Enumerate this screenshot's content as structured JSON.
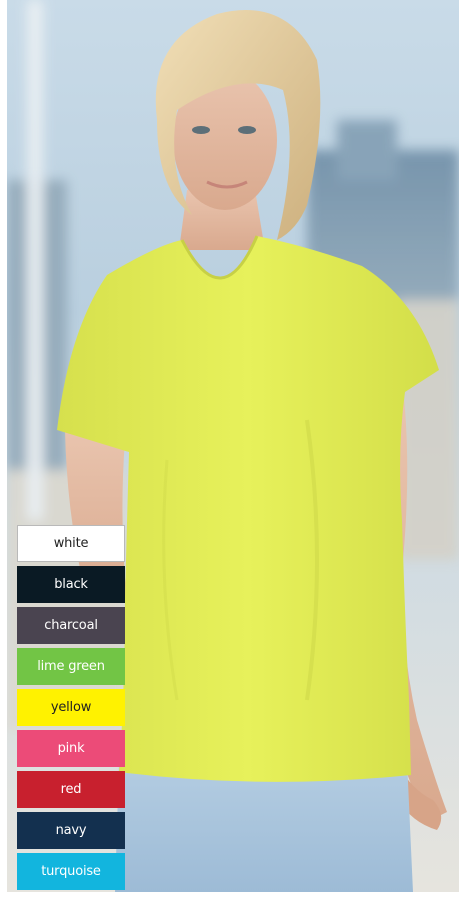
{
  "product_photo": {
    "description_icon": "model-photo",
    "shirt_color": "#e4ee57",
    "background_sky": "#c6d8e6",
    "jeans_color": "#aac6df"
  },
  "swatches": [
    {
      "label": "white",
      "bg": "#ffffff",
      "fg": "#222222"
    },
    {
      "label": "black",
      "bg": "#0a1a24",
      "fg": "#ffffff"
    },
    {
      "label": "charcoal",
      "bg": "#4a4450",
      "fg": "#ffffff"
    },
    {
      "label": "lime green",
      "bg": "#72c545",
      "fg": "#ffffff"
    },
    {
      "label": "yellow",
      "bg": "#fff200",
      "fg": "#222222"
    },
    {
      "label": "pink",
      "bg": "#ec4b78",
      "fg": "#ffffff"
    },
    {
      "label": "red",
      "bg": "#c8202e",
      "fg": "#ffffff"
    },
    {
      "label": "navy",
      "bg": "#13304f",
      "fg": "#ffffff"
    },
    {
      "label": "turquoise",
      "bg": "#12b5de",
      "fg": "#ffffff"
    }
  ]
}
